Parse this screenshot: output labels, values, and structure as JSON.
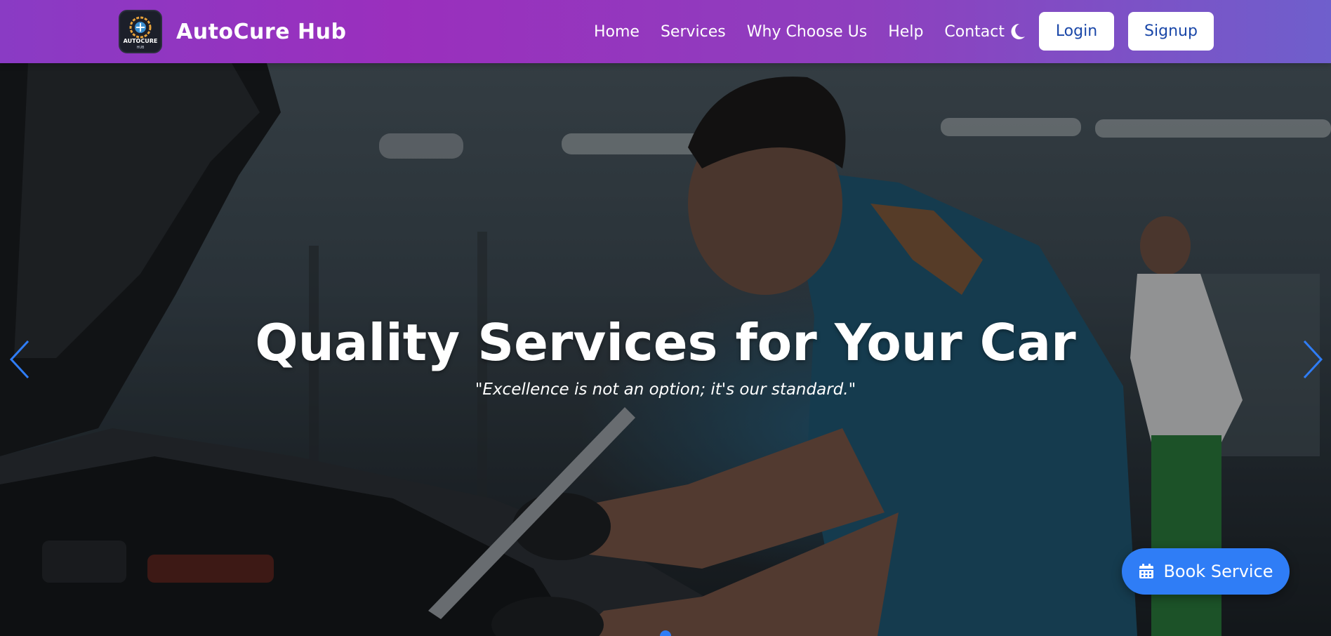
{
  "brand": {
    "name": "AutoCure Hub",
    "logo_text": "AUTOCURE",
    "logo_subtext": "HUB"
  },
  "nav": {
    "links": [
      "Home",
      "Services",
      "Why Choose Us",
      "Help",
      "Contact"
    ],
    "theme_toggle_icon": "moon-icon",
    "login_label": "Login",
    "signup_label": "Signup"
  },
  "hero": {
    "title": "Quality Services for Your Car",
    "quote": "\"Excellence is not an option; it's our standard.\"",
    "prev_icon": "chevron-left-icon",
    "next_icon": "chevron-right-icon",
    "active_slide": 1
  },
  "cta": {
    "book_label": "Book Service",
    "book_icon": "calendar-icon"
  },
  "colors": {
    "nav_gradient_start": "#8a3bc4",
    "nav_gradient_end": "#6f5fcc",
    "accent_blue": "#2f7df6",
    "button_text": "#1a47a8"
  }
}
